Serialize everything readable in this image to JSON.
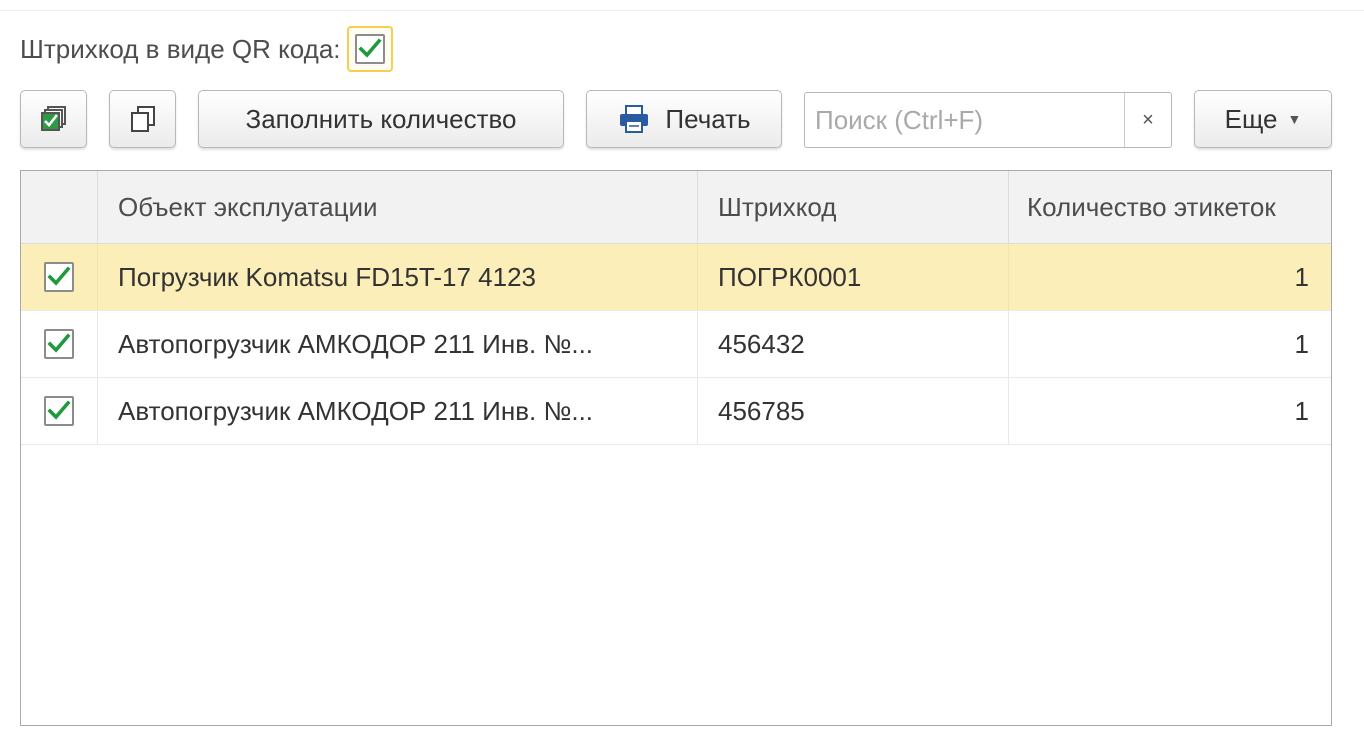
{
  "qr_option": {
    "label": "Штрихкод в виде QR кода:",
    "checked": true
  },
  "toolbar": {
    "check_all_icon": "check-all-icon",
    "copy_icon": "copy-icon",
    "fill_label": "Заполнить количество",
    "print_label": "Печать",
    "print_icon": "printer-icon",
    "search_placeholder": "Поиск (Ctrl+F)",
    "search_value": "",
    "search_clear": "×",
    "more_label": "Еще",
    "more_arrow": "▼"
  },
  "table": {
    "columns": [
      "",
      "Объект эксплуатации",
      "Штрихкод",
      "Количество этикеток"
    ],
    "rows": [
      {
        "checked": true,
        "object": "Погрузчик Komatsu FD15T-17 4123",
        "barcode": "ПОГРК0001",
        "qty": "1",
        "selected": true
      },
      {
        "checked": true,
        "object": "Автопогрузчик АМКОДОР 211 Инв. №...",
        "barcode": "456432",
        "qty": "1",
        "selected": false
      },
      {
        "checked": true,
        "object": "Автопогрузчик АМКОДОР 211 Инв. №...",
        "barcode": "456785",
        "qty": "1",
        "selected": false
      }
    ]
  },
  "colors": {
    "selected_row": "#fbeeb8",
    "check_mark": "#1e9a3c",
    "focus_border": "#f2d14f"
  }
}
